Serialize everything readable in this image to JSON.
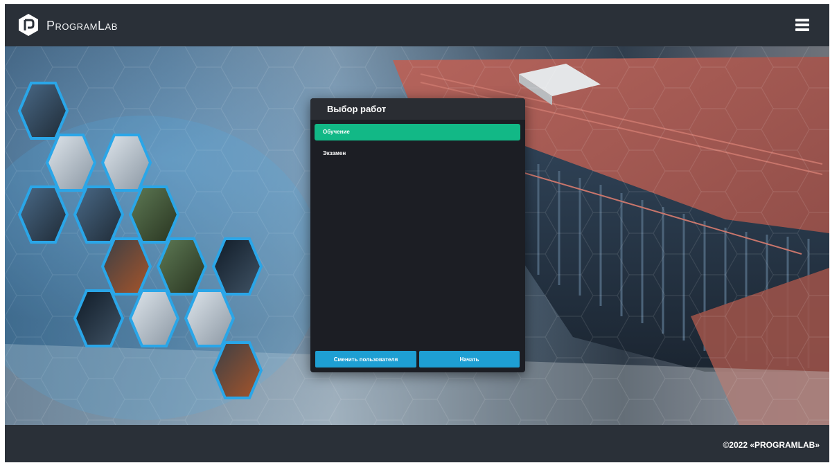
{
  "app": {
    "brand": "ProgramLab"
  },
  "dialog": {
    "title": "Выбор работ",
    "items": [
      {
        "label": "Обучение",
        "selected": true
      },
      {
        "label": "Экзамен",
        "selected": false
      }
    ],
    "change_user_label": "Сменить пользователя",
    "start_label": "Начать"
  },
  "footer": {
    "copyright": "©2022 «PROGRAMLAB»"
  },
  "colors": {
    "accent": "#1e9fd3",
    "selected": "#12b886",
    "header": "#2a3038",
    "dialog": "#1c1e24"
  },
  "icons": [
    "programlab-logo",
    "hamburger-menu-icon"
  ]
}
